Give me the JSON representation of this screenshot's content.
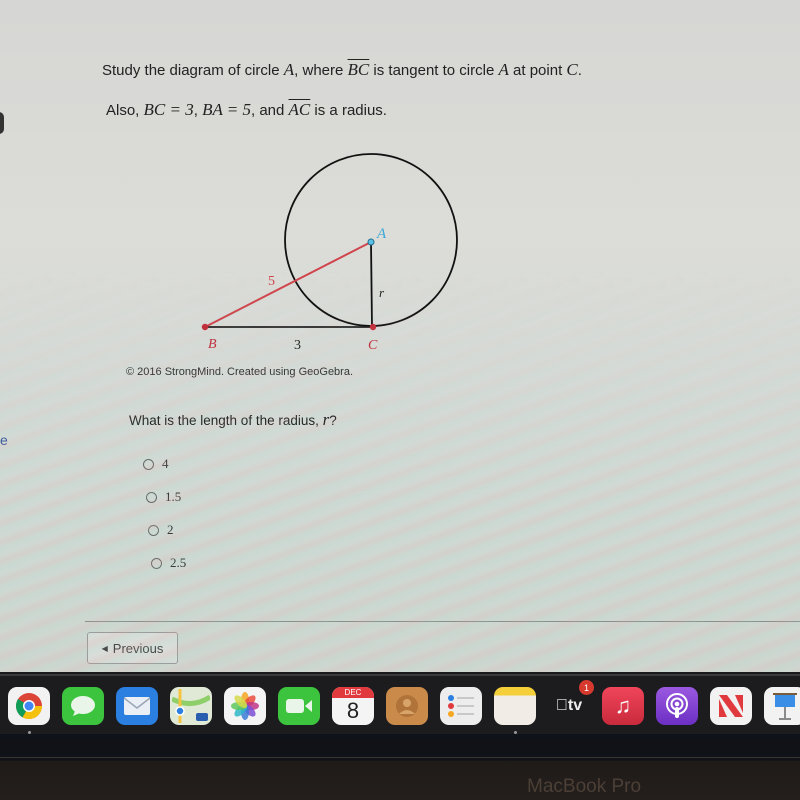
{
  "question": {
    "prompt_line1": {
      "pre": "Study the diagram of circle ",
      "var_a": "A",
      "mid1": ", where ",
      "seg_bc": "BC",
      "mid2": " is tangent to circle ",
      "var_a2": "A",
      "mid3": " at point ",
      "var_c": "C",
      "end": "."
    },
    "prompt_line2": {
      "pre": "Also, ",
      "eq1": "BC = 3",
      "sep1": ", ",
      "eq2": "BA = 5",
      "mid": ", and ",
      "seg_ac": "AC",
      "end": " is a radius."
    },
    "diagram": {
      "labels": {
        "A": "A",
        "B": "B",
        "C": "C",
        "BA_length": "5",
        "BC_length": "3",
        "AC_label": "r"
      },
      "colors": {
        "segment_BA": "#d0454d",
        "point_B": "#c0303c",
        "point_C": "#c0303c",
        "point_A": "#2f9fcf",
        "label_A": "#3aa7d6",
        "label_BC": "#c0303c",
        "circle": "#111111"
      }
    },
    "credit": "© 2016 StrongMind. Created using GeoGebra.",
    "ask_pre": "What is the length of the radius, ",
    "ask_var": "r",
    "ask_end": "?",
    "options": [
      {
        "label": "4",
        "selected": false
      },
      {
        "label": "1.5",
        "selected": false
      },
      {
        "label": "2",
        "selected": false
      },
      {
        "label": "2.5",
        "selected": false
      }
    ]
  },
  "navigation": {
    "previous_label": "Previous"
  },
  "sidebar_fragment": {
    "letter": "e"
  },
  "dock": {
    "apps": [
      {
        "name": "Chrome",
        "running": true
      },
      {
        "name": "Messages"
      },
      {
        "name": "Mail"
      },
      {
        "name": "Maps",
        "shield": "280"
      },
      {
        "name": "Photos"
      },
      {
        "name": "FaceTime"
      },
      {
        "name": "Calendar",
        "month": "DEC",
        "day": "8"
      },
      {
        "name": "Contacts"
      },
      {
        "name": "Reminders"
      },
      {
        "name": "Notes",
        "running": true
      },
      {
        "name": "Apple TV",
        "label": "tv",
        "badge": "1"
      },
      {
        "name": "Music"
      },
      {
        "name": "Podcasts"
      },
      {
        "name": "News"
      },
      {
        "name": "Keynote"
      }
    ]
  },
  "device": {
    "brand": "MacBook Pro"
  }
}
